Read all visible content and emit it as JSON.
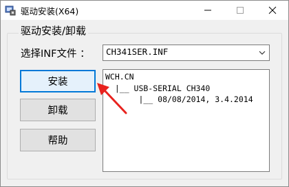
{
  "window": {
    "title": "驱动安装(X64)"
  },
  "group": {
    "title": "驱动安装/卸载"
  },
  "inf": {
    "label": "选择INF文件 ：",
    "selected": "CH341SER.INF"
  },
  "buttons": {
    "install": "安装",
    "uninstall": "卸载",
    "help": "帮助"
  },
  "info": {
    "lines": [
      "WCH.CN",
      "  |__ USB-SERIAL CH340",
      "       |__ 08/08/2014, 3.4.2014"
    ]
  },
  "icons": {
    "app": "driver-install-icon",
    "minimize": "minimize-icon",
    "maximize": "maximize-icon",
    "close": "close-icon",
    "dropdown": "chevron-down-icon",
    "annotation": "red-arrow-annotation"
  },
  "colors": {
    "annotation_arrow": "#e8221e",
    "default_button_border": "#0078d7"
  }
}
